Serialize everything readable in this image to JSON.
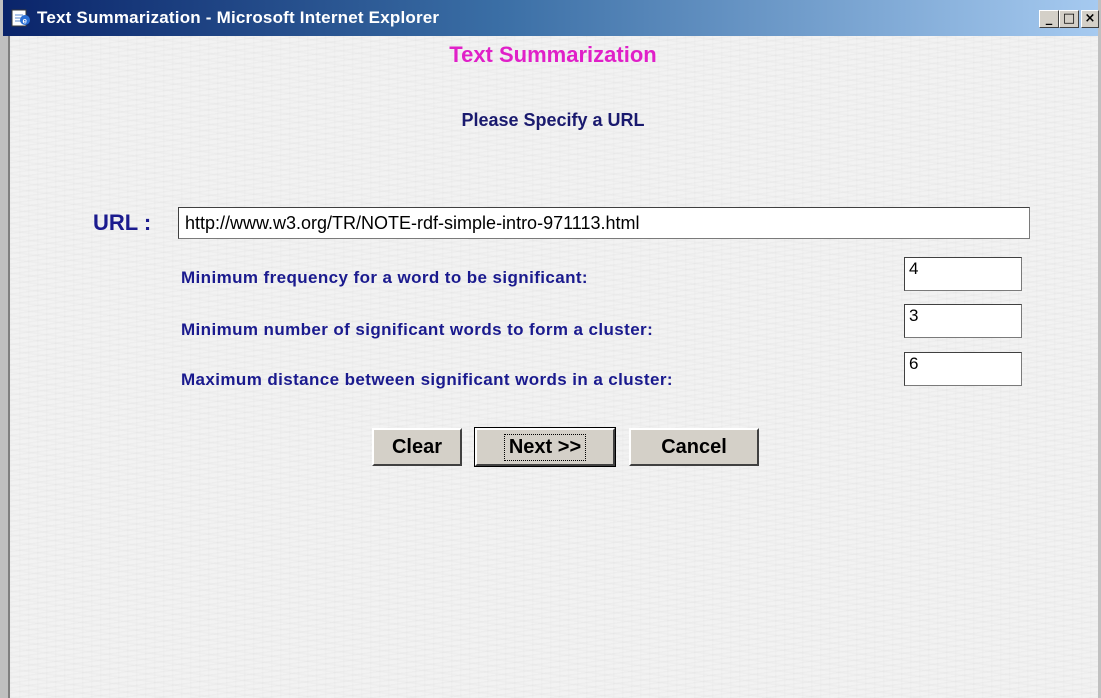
{
  "window": {
    "title": "Text Summarization - Microsoft Internet Explorer",
    "minimize_label": "_",
    "maximize_label": "□",
    "close_label": "×"
  },
  "page": {
    "title": "Text Summarization",
    "subtitle": "Please Specify a URL"
  },
  "form": {
    "url_label": "URL :",
    "url_value": "http://www.w3.org/TR/NOTE-rdf-simple-intro-971113.html",
    "params": [
      {
        "label": "Minimum frequency for a word to be significant:",
        "value": "4"
      },
      {
        "label": "Minimum number of significant words to form a cluster:",
        "value": "3"
      },
      {
        "label": "Maximum distance between significant words in a cluster:",
        "value": "6"
      }
    ],
    "buttons": {
      "clear": "Clear",
      "next": "Next >>",
      "cancel": "Cancel"
    }
  },
  "colors": {
    "title": "#e020c8",
    "label": "#1a1a8e",
    "titlebar_start": "#0a246a",
    "titlebar_end": "#a6caf0"
  },
  "icons": {
    "browser": "ie-page-icon"
  }
}
